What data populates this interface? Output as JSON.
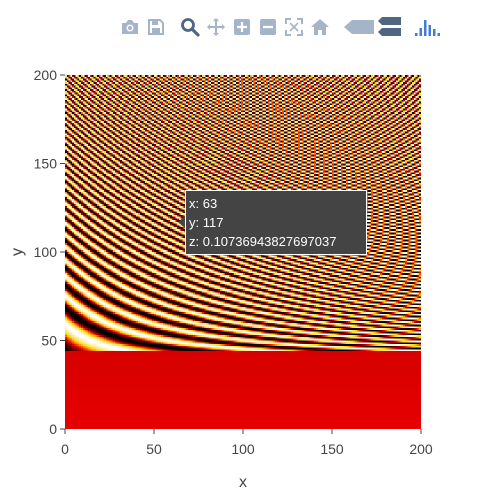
{
  "toolbar": {
    "buttons": [
      {
        "icon": "camera-icon"
      },
      {
        "icon": "save-icon"
      },
      {
        "icon": "zoom-icon"
      },
      {
        "icon": "pan-icon"
      },
      {
        "icon": "zoom-in-icon"
      },
      {
        "icon": "zoom-out-icon"
      },
      {
        "icon": "autoscale-icon"
      },
      {
        "icon": "home-icon"
      },
      {
        "icon": "hover-closest-icon"
      },
      {
        "icon": "hover-compare-icon"
      },
      {
        "icon": "plotly-logo-icon"
      }
    ],
    "icon_color": "#a6b4ca",
    "active_color": "#506784",
    "logo_color": "#447adb"
  },
  "chart_data": {
    "type": "heatmap",
    "title": "",
    "xlabel": "x",
    "ylabel": "y",
    "xlim": [
      0,
      200
    ],
    "ylim": [
      0,
      200
    ],
    "x_ticks": [
      0,
      50,
      100,
      150,
      200
    ],
    "y_ticks": [
      0,
      50,
      100,
      150,
      200
    ],
    "x_tick_labels": [
      "0",
      "50",
      "100",
      "150",
      "200"
    ],
    "y_tick_labels": [
      "0",
      "50",
      "100",
      "150",
      "200"
    ],
    "grid": false,
    "colorscale": "Hot",
    "colors": [
      "#000000",
      "#e60000",
      "#ffd200",
      "#ffffff"
    ],
    "hover": {
      "x_text": "x: 63",
      "y_text": "y: 117",
      "z_text": "z: 0.10736943827697037"
    }
  }
}
